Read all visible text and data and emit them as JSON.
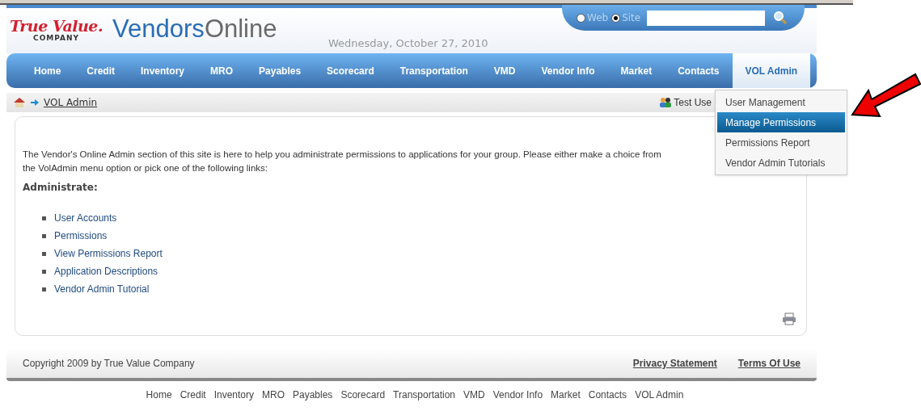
{
  "header": {
    "logo_text": "True Value.",
    "logo_sub": "COMPANY",
    "site_title_a": "Vendors",
    "site_title_b": "Online",
    "date": "Wednesday, October 27, 2010"
  },
  "search": {
    "scopes": [
      {
        "label": "Web",
        "selected": false
      },
      {
        "label": "Site",
        "selected": true
      }
    ]
  },
  "nav": [
    {
      "label": "Home",
      "selected": false
    },
    {
      "label": "Credit",
      "selected": false
    },
    {
      "label": "Inventory",
      "selected": false
    },
    {
      "label": "MRO",
      "selected": false
    },
    {
      "label": "Payables",
      "selected": false
    },
    {
      "label": "Scorecard",
      "selected": false
    },
    {
      "label": "Transportation",
      "selected": false
    },
    {
      "label": "VMD",
      "selected": false
    },
    {
      "label": "Vendor Info",
      "selected": false
    },
    {
      "label": "Market",
      "selected": false
    },
    {
      "label": "Contacts",
      "selected": false
    },
    {
      "label": "VOL Admin",
      "selected": true
    }
  ],
  "dropdown": [
    {
      "label": "User Management",
      "selected": false
    },
    {
      "label": "Manage Permissions",
      "selected": true
    },
    {
      "label": "Permissions Report",
      "selected": false
    },
    {
      "label": "Vendor Admin Tutorials",
      "selected": false
    }
  ],
  "breadcrumb": {
    "link": "VOL Admin",
    "user": "Test Use"
  },
  "content": {
    "intro_lines": [
      "The Vendor's Online Admin section of this site is here to help you administrate permissions to applications for your group. Please either make a choice from",
      "the VolAdmin menu option or pick one of the following links:"
    ],
    "heading": "Administrate:",
    "links": [
      "User Accounts",
      "Permissions",
      "View Permissions Report",
      "Application Descriptions",
      "Vendor Admin Tutorial"
    ]
  },
  "footer": {
    "copyright": "Copyright 2009 by True Value Company",
    "links": [
      "Privacy Statement",
      "Terms Of Use"
    ]
  },
  "bottom_links": [
    "Home",
    "Credit",
    "Inventory",
    "MRO",
    "Payables",
    "Scorecard",
    "Transportation",
    "VMD",
    "Vendor Info",
    "Market",
    "Contacts",
    "VOL Admin"
  ]
}
